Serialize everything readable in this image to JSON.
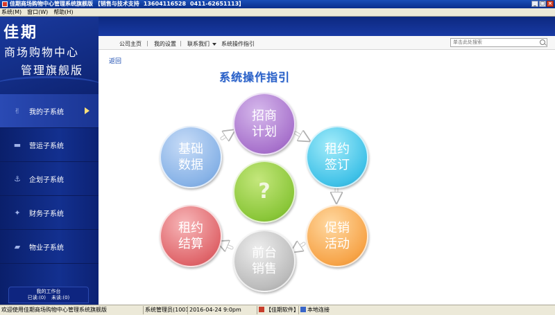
{
  "window": {
    "title": "佳期商场购物中心管理系统旗舰版",
    "support_label": "【销售与技术支持",
    "phone_1": "13604116528",
    "phone_2": "0411-62651113】",
    "buttons": {
      "minimize": "_",
      "maximize": "□",
      "close": "×"
    }
  },
  "menubar": [
    {
      "label": "系统(M)"
    },
    {
      "label": "窗口(W)"
    },
    {
      "label": "帮助(H)"
    }
  ],
  "logo": {
    "brand": "佳期",
    "line1": "商场购物中心",
    "line2": "管理旗舰版"
  },
  "sidebar": {
    "items": [
      {
        "label": "我的子系统",
        "icon": "handshake-icon",
        "active": true
      },
      {
        "label": "营运子系统",
        "icon": "folder-icon",
        "active": false
      },
      {
        "label": "企划子系统",
        "icon": "anchor-icon",
        "active": false
      },
      {
        "label": "财务子系统",
        "icon": "finance-icon",
        "active": false
      },
      {
        "label": "物业子系统",
        "icon": "property-icon",
        "active": false
      }
    ],
    "workbench": {
      "title": "我的工作台",
      "done": "已读:(0)",
      "unread": "未读:(0)"
    }
  },
  "linkbar": {
    "items": [
      {
        "label": "公司主页"
      },
      {
        "label": "我的设置"
      },
      {
        "label": "联系我们"
      },
      {
        "label": "系统操作指引"
      }
    ],
    "separator": "|",
    "search_placeholder": "单击此处搜索"
  },
  "main": {
    "back_label": "返回",
    "title": "系统操作指引",
    "steps": [
      {
        "line1": "招商",
        "line2": "计划",
        "color": "#a974cd"
      },
      {
        "line1": "租约",
        "line2": "签订",
        "color": "#41c2e8"
      },
      {
        "line1": "促销",
        "line2": "活动",
        "color": "#f7a54a"
      },
      {
        "line1": "前台",
        "line2": "销售",
        "color": "#bcbcbc"
      },
      {
        "line1": "租约",
        "line2": "结算",
        "color": "#e0676c"
      },
      {
        "line1": "基础",
        "line2": "数据",
        "color": "#88b3e7"
      }
    ],
    "center_symbol": "?",
    "center_color": "#8bc73a"
  },
  "statusbar": {
    "welcome": "欢迎使用佳期商场购物中心管理系统旗舰版",
    "user": "系统管理员(1001)",
    "datetime": "2016-04-24 9:0pm",
    "vendor": "【佳期软件】",
    "connection": "本地连接"
  }
}
